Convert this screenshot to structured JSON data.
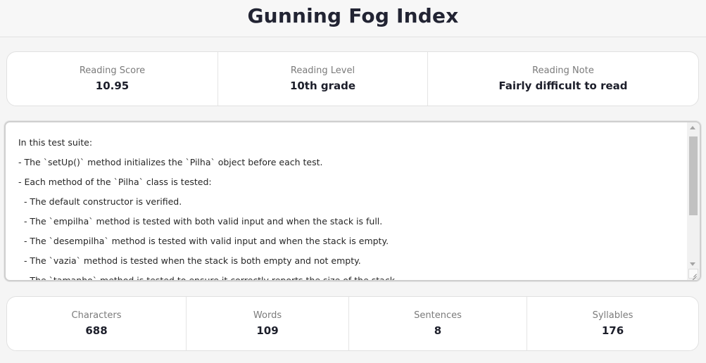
{
  "header": {
    "title": "Gunning Fog Index"
  },
  "summary": [
    {
      "label": "Reading Score",
      "value": "10.95"
    },
    {
      "label": "Reading Level",
      "value": "10th grade"
    },
    {
      "label": "Reading Note",
      "value": "Fairly difficult to read"
    }
  ],
  "editor": {
    "lines": [
      "In this test suite:",
      "- The `setUp()` method initializes the `Pilha` object before each test.",
      "- Each method of the `Pilha` class is tested:",
      "  - The default constructor is verified.",
      "  - The `empilha` method is tested with both valid input and when the stack is full.",
      "  - The `desempilha` method is tested with valid input and when the stack is empty.",
      "  - The `vazia` method is tested when the stack is both empty and not empty.",
      "  - The `tamanho` method is tested to ensure it correctly reports the size of the stack."
    ]
  },
  "counts": [
    {
      "label": "Characters",
      "value": "688"
    },
    {
      "label": "Words",
      "value": "109"
    },
    {
      "label": "Sentences",
      "value": "8"
    },
    {
      "label": "Syllables",
      "value": "176"
    }
  ]
}
